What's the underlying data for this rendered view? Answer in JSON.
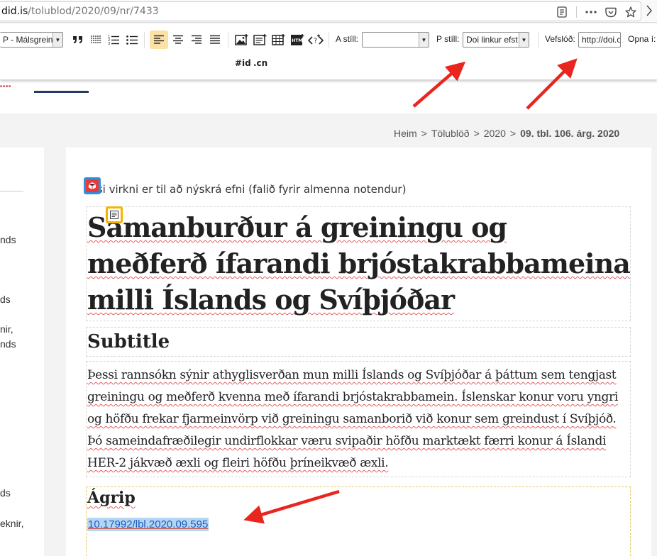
{
  "browser": {
    "url_prefix": "did.is",
    "url_path": "/tolublod/2020/09/nr/7433"
  },
  "toolbar": {
    "paragraph_style": "P - Málsgrein",
    "a_style_label": "A stíll:",
    "a_style_value": "",
    "p_style_label": "P stíll:",
    "p_style_value": "Doi linkur efst",
    "url_label": "Vefslóð:",
    "url_value": "http://doi.o",
    "open_label": "Opna í:",
    "id_button": "#id",
    "class_button": ".cn"
  },
  "breadcrumb": {
    "home": "Heim",
    "issues": "Tölublöð",
    "year": "2020",
    "current": "09. tbl. 106. árg. 2020",
    "separator": ">"
  },
  "sidebar_fragments": [
    "nds",
    "ds",
    "nir,",
    "nds",
    "ds",
    "eknir,"
  ],
  "article": {
    "notice": "ssi virkni er til að nýskrá efni (falið fyrir almenna notendur)",
    "title": "Samanburður á greiningu og meðferð ífarandi brjóstakrabbameina milli Íslands og Svíþjóðar",
    "subtitle": "Subtitle",
    "abstract": "Þessi rannsókn sýnir athyglisverðan mun milli Íslands og Svíþjóðar á þáttum sem tengjast greiningu og meðferð kvenna með ífarandi brjóstakrabbamein. Íslenskar konur voru yngri og höfðu frekar fjarmeinvörp við greiningu samanborið við konur sem greindust í Svíþjóð. Þó sameindafræðilegir undirflokkar væru svipaðir höfðu marktækt færri konur á Íslandi HER-2 jákvæð æxli og fleiri höfðu þríneikvæð æxli.",
    "section_heading": "Ágrip",
    "doi": "10.17992/lbl.2020.09.595"
  },
  "colors": {
    "accent_navy": "#213c67",
    "annotation_arrow": "#e8261f",
    "link_blue": "#1a5dbf",
    "selection": "#b5d5f5"
  }
}
